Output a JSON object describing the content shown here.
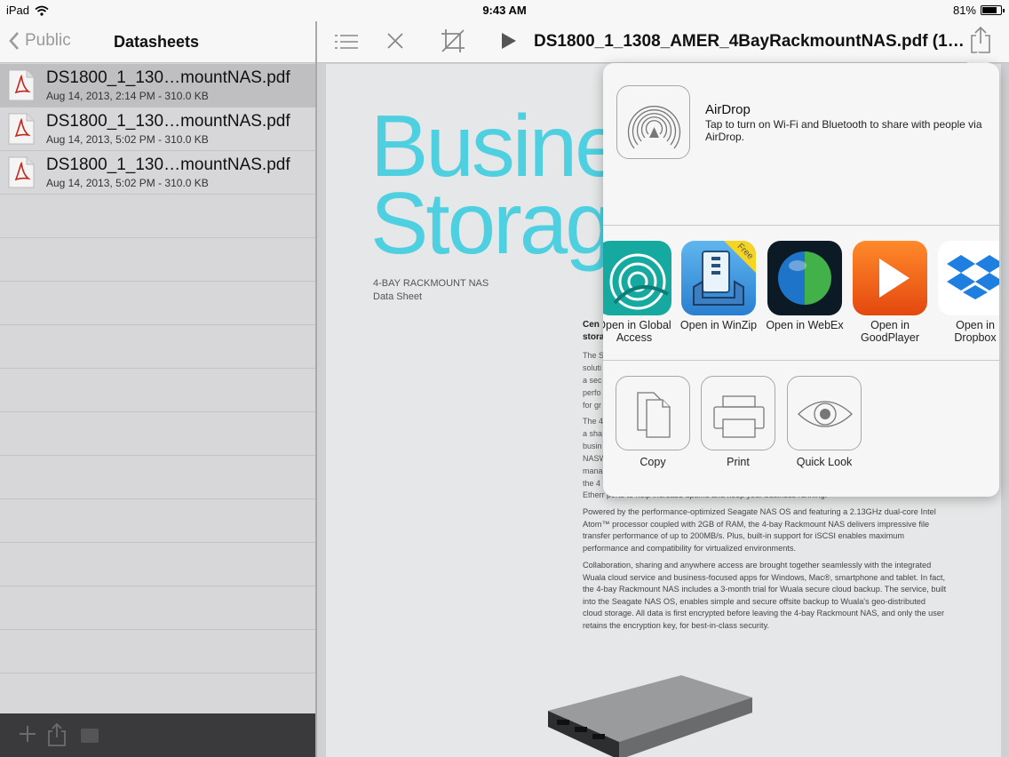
{
  "status_bar": {
    "device": "iPad",
    "time": "9:43 AM",
    "battery": "81%",
    "battery_level": 0.81
  },
  "sidebar": {
    "back_label": "Public",
    "title": "Datasheets",
    "files": [
      {
        "name": "DS1800_1_130…mountNAS.pdf",
        "meta": "Aug 14, 2013, 2:14 PM - 310.0 KB",
        "selected": true
      },
      {
        "name": "DS1800_1_130…mountNAS.pdf",
        "meta": "Aug 14, 2013, 5:02 PM - 310.0 KB",
        "selected": false
      },
      {
        "name": "DS1800_1_130…mountNAS.pdf",
        "meta": "Aug 14, 2013, 5:02 PM - 310.0 KB",
        "selected": false
      }
    ],
    "toolbar_icons": [
      "add-icon",
      "share-icon",
      "folder-icon"
    ]
  },
  "toolbar": {
    "icons": [
      "list-icon",
      "close-icon",
      "crop-icon",
      "play-icon",
      "share-icon"
    ],
    "document_title": "DS1800_1_1308_AMER_4BayRackmountNAS.pdf (1…"
  },
  "document": {
    "headline_1": "Busine",
    "headline_2": "Storag",
    "product": "4-BAY RACKMOUNT NAS",
    "doc_type": "Data Sheet",
    "heading_fragment_1": "Cen",
    "heading_fragment_2": "stora",
    "fragments": [
      "The S",
      "soluti",
      "a sec",
      "perfo",
      "for gr",
      "The 4",
      "a sha",
      "busin",
      "NASW",
      "mana",
      "the 4",
      "Etherr ports to help increase uptime and keep your business running."
    ],
    "paragraph_2": "Powered by the performance-optimized Seagate NAS OS and featuring a 2.13GHz dual-core Intel Atom™ processor coupled with 2GB of RAM, the 4-bay Rackmount NAS delivers impressive file transfer performance of up to 200MB/s. Plus, built-in support for iSCSI enables maximum performance and compatibility for virtualized environments.",
    "paragraph_3": "Collaboration, sharing and anywhere access are brought together seamlessly with the integrated Wuala cloud service and business-focused apps for Windows, Mac®, smartphone and tablet. In fact, the 4-bay Rackmount NAS includes a 3-month trial for Wuala secure cloud backup. The service, built into the Seagate NAS OS, enables simple and secure offsite backup to Wuala's geo-distributed cloud storage. All data is first encrypted before leaving the 4-bay Rackmount NAS, and only the user retains the encryption key, for best-in-class security."
  },
  "share_sheet": {
    "airdrop_title": "AirDrop",
    "airdrop_desc": "Tap to turn on Wi-Fi and Bluetooth to share with people via AirDrop.",
    "apps": [
      {
        "label": "Open in Global Access",
        "icon": "global-access-icon"
      },
      {
        "label": "Open in WinZip",
        "icon": "winzip-icon",
        "badge": "Free"
      },
      {
        "label": "Open in WebEx",
        "icon": "webex-icon"
      },
      {
        "label": "Open in GoodPlayer",
        "icon": "goodplayer-icon"
      },
      {
        "label": "Open in Dropbox",
        "icon": "dropbox-icon"
      }
    ],
    "actions": [
      {
        "label": "Copy",
        "icon": "copy-icon"
      },
      {
        "label": "Print",
        "icon": "print-icon"
      },
      {
        "label": "Quick Look",
        "icon": "eye-icon"
      }
    ]
  },
  "colors": {
    "headline": "#4ed0e0",
    "goodplayer": "#f26a1b",
    "dropbox": "#1f7fe0",
    "winzip": "#3a9ae0"
  }
}
